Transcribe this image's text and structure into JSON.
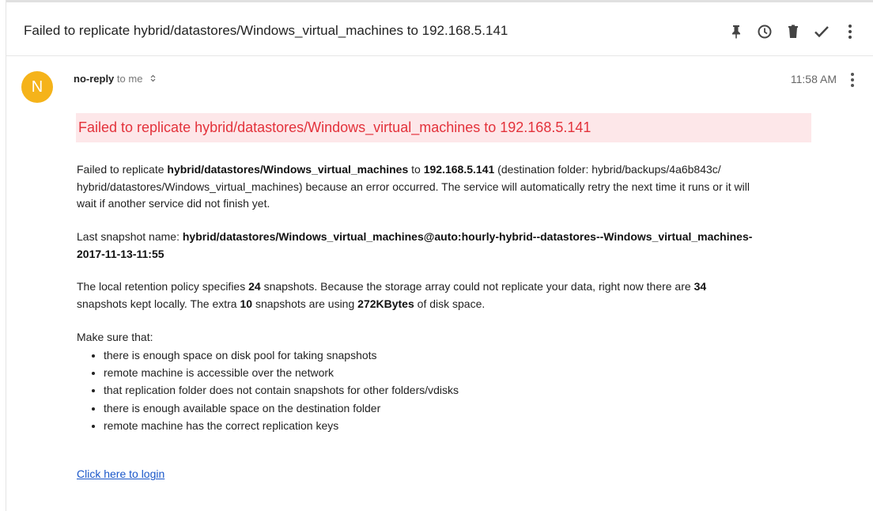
{
  "subject": "Failed to replicate hybrid/datastores/Windows_virtual_machines to 192.168.5.141",
  "toolbar": {
    "pin_icon": "pin-icon",
    "snooze_icon": "clock-icon",
    "delete_icon": "trash-icon",
    "done_icon": "check-icon",
    "more_icon": "more-vert-icon"
  },
  "sender": {
    "avatar_letter": "N",
    "avatar_color": "#f5b31a",
    "name": "no-reply",
    "recipient": "to me",
    "details_icon": "unfold-caret-icon",
    "time": "11:58 AM"
  },
  "email": {
    "alert_title": "Failed to replicate hybrid/datastores/Windows_virtual_machines to 192.168.5.141",
    "p1": {
      "t1": "Failed to replicate ",
      "b1": "hybrid/datastores/Windows_virtual_machines",
      "t2": " to ",
      "b2": "192.168.5.141",
      "t3": " (destination folder: hybrid/backups/4a6b843c/",
      "t4": "hybrid/datastores/Windows_virtual_machines) because an error occurred. The service will automatically retry the next time it runs or it will",
      "t5": "wait if another service did not finish yet."
    },
    "p2": {
      "t1": "Last snapshot name: ",
      "b1": "hybrid/datastores/Windows_virtual_machines@auto:hourly-hybrid--datastores--Windows_virtual_machines-",
      "b2": "2017-11-13-11:55"
    },
    "p3": {
      "t1": "The local retention policy specifies ",
      "b1": "24",
      "t2": " snapshots. Because the storage array could not replicate your data, right now there are ",
      "b2": "34",
      "t3": "snapshots kept locally. The extra ",
      "b3": "10",
      "t4": " snapshots are using ",
      "b4": "272KBytes",
      "t5": " of disk space."
    },
    "checklist_intro": "Make sure that:",
    "checklist": [
      "there is enough space on disk pool for taking snapshots",
      "remote machine is accessible over the network",
      "that replication folder does not contain snapshots for other folders/vdisks",
      "there is enough available space on the destination folder",
      "remote machine has the correct replication keys"
    ],
    "login_link": "Click here to login"
  },
  "colors": {
    "alert_bg": "#fde7e9",
    "alert_text": "#e3323b",
    "link": "#1a57c9"
  }
}
